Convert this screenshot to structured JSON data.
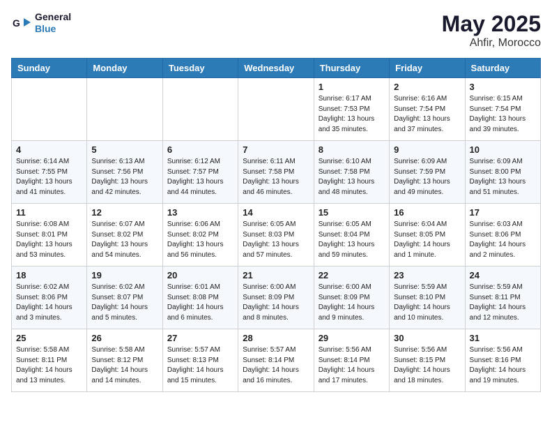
{
  "header": {
    "logo_line1": "General",
    "logo_line2": "Blue",
    "month": "May 2025",
    "location": "Ahfir, Morocco"
  },
  "weekdays": [
    "Sunday",
    "Monday",
    "Tuesday",
    "Wednesday",
    "Thursday",
    "Friday",
    "Saturday"
  ],
  "weeks": [
    [
      {
        "day": "",
        "content": ""
      },
      {
        "day": "",
        "content": ""
      },
      {
        "day": "",
        "content": ""
      },
      {
        "day": "",
        "content": ""
      },
      {
        "day": "1",
        "content": "Sunrise: 6:17 AM\nSunset: 7:53 PM\nDaylight: 13 hours\nand 35 minutes."
      },
      {
        "day": "2",
        "content": "Sunrise: 6:16 AM\nSunset: 7:54 PM\nDaylight: 13 hours\nand 37 minutes."
      },
      {
        "day": "3",
        "content": "Sunrise: 6:15 AM\nSunset: 7:54 PM\nDaylight: 13 hours\nand 39 minutes."
      }
    ],
    [
      {
        "day": "4",
        "content": "Sunrise: 6:14 AM\nSunset: 7:55 PM\nDaylight: 13 hours\nand 41 minutes."
      },
      {
        "day": "5",
        "content": "Sunrise: 6:13 AM\nSunset: 7:56 PM\nDaylight: 13 hours\nand 42 minutes."
      },
      {
        "day": "6",
        "content": "Sunrise: 6:12 AM\nSunset: 7:57 PM\nDaylight: 13 hours\nand 44 minutes."
      },
      {
        "day": "7",
        "content": "Sunrise: 6:11 AM\nSunset: 7:58 PM\nDaylight: 13 hours\nand 46 minutes."
      },
      {
        "day": "8",
        "content": "Sunrise: 6:10 AM\nSunset: 7:58 PM\nDaylight: 13 hours\nand 48 minutes."
      },
      {
        "day": "9",
        "content": "Sunrise: 6:09 AM\nSunset: 7:59 PM\nDaylight: 13 hours\nand 49 minutes."
      },
      {
        "day": "10",
        "content": "Sunrise: 6:09 AM\nSunset: 8:00 PM\nDaylight: 13 hours\nand 51 minutes."
      }
    ],
    [
      {
        "day": "11",
        "content": "Sunrise: 6:08 AM\nSunset: 8:01 PM\nDaylight: 13 hours\nand 53 minutes."
      },
      {
        "day": "12",
        "content": "Sunrise: 6:07 AM\nSunset: 8:02 PM\nDaylight: 13 hours\nand 54 minutes."
      },
      {
        "day": "13",
        "content": "Sunrise: 6:06 AM\nSunset: 8:02 PM\nDaylight: 13 hours\nand 56 minutes."
      },
      {
        "day": "14",
        "content": "Sunrise: 6:05 AM\nSunset: 8:03 PM\nDaylight: 13 hours\nand 57 minutes."
      },
      {
        "day": "15",
        "content": "Sunrise: 6:05 AM\nSunset: 8:04 PM\nDaylight: 13 hours\nand 59 minutes."
      },
      {
        "day": "16",
        "content": "Sunrise: 6:04 AM\nSunset: 8:05 PM\nDaylight: 14 hours\nand 1 minute."
      },
      {
        "day": "17",
        "content": "Sunrise: 6:03 AM\nSunset: 8:06 PM\nDaylight: 14 hours\nand 2 minutes."
      }
    ],
    [
      {
        "day": "18",
        "content": "Sunrise: 6:02 AM\nSunset: 8:06 PM\nDaylight: 14 hours\nand 3 minutes."
      },
      {
        "day": "19",
        "content": "Sunrise: 6:02 AM\nSunset: 8:07 PM\nDaylight: 14 hours\nand 5 minutes."
      },
      {
        "day": "20",
        "content": "Sunrise: 6:01 AM\nSunset: 8:08 PM\nDaylight: 14 hours\nand 6 minutes."
      },
      {
        "day": "21",
        "content": "Sunrise: 6:00 AM\nSunset: 8:09 PM\nDaylight: 14 hours\nand 8 minutes."
      },
      {
        "day": "22",
        "content": "Sunrise: 6:00 AM\nSunset: 8:09 PM\nDaylight: 14 hours\nand 9 minutes."
      },
      {
        "day": "23",
        "content": "Sunrise: 5:59 AM\nSunset: 8:10 PM\nDaylight: 14 hours\nand 10 minutes."
      },
      {
        "day": "24",
        "content": "Sunrise: 5:59 AM\nSunset: 8:11 PM\nDaylight: 14 hours\nand 12 minutes."
      }
    ],
    [
      {
        "day": "25",
        "content": "Sunrise: 5:58 AM\nSunset: 8:11 PM\nDaylight: 14 hours\nand 13 minutes."
      },
      {
        "day": "26",
        "content": "Sunrise: 5:58 AM\nSunset: 8:12 PM\nDaylight: 14 hours\nand 14 minutes."
      },
      {
        "day": "27",
        "content": "Sunrise: 5:57 AM\nSunset: 8:13 PM\nDaylight: 14 hours\nand 15 minutes."
      },
      {
        "day": "28",
        "content": "Sunrise: 5:57 AM\nSunset: 8:14 PM\nDaylight: 14 hours\nand 16 minutes."
      },
      {
        "day": "29",
        "content": "Sunrise: 5:56 AM\nSunset: 8:14 PM\nDaylight: 14 hours\nand 17 minutes."
      },
      {
        "day": "30",
        "content": "Sunrise: 5:56 AM\nSunset: 8:15 PM\nDaylight: 14 hours\nand 18 minutes."
      },
      {
        "day": "31",
        "content": "Sunrise: 5:56 AM\nSunset: 8:16 PM\nDaylight: 14 hours\nand 19 minutes."
      }
    ]
  ]
}
